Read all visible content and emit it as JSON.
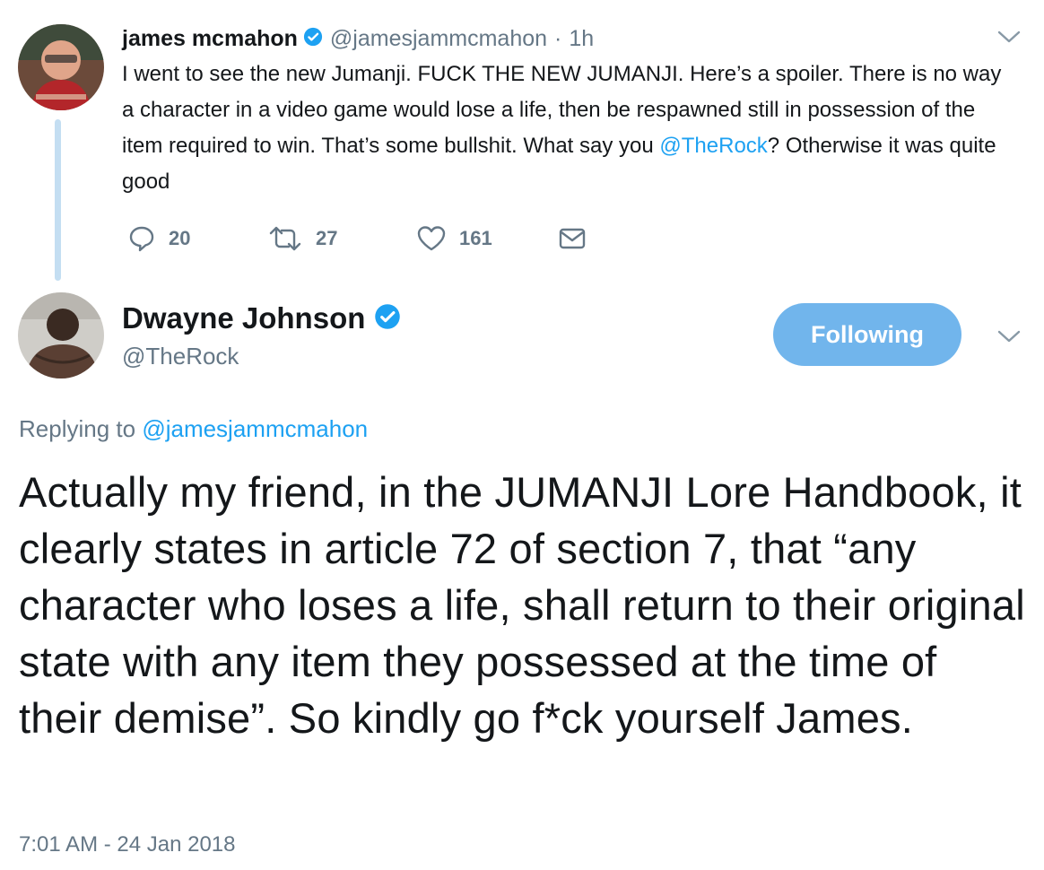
{
  "tweet1": {
    "name": "james mcmahon",
    "handle": "@jamesjammcmahon",
    "separator": "·",
    "time": "1h",
    "text_part1": "I went to see the new Jumanji. FUCK THE NEW JUMANJI. Here’s a spoiler. There is no way a character in a video game would lose a life, then be respawned still in possession of the item required to win. That’s some bullshit. What say you ",
    "mention": "@TheRock",
    "text_part2": "? Otherwise it was quite good",
    "actions": {
      "replies": "20",
      "retweets": "27",
      "likes": "161"
    }
  },
  "tweet2": {
    "name": "Dwayne Johnson",
    "handle": "@TheRock",
    "follow_label": "Following",
    "replying_prefix": "Replying to ",
    "replying_handle": "@jamesjammcmahon",
    "text": "Actually my friend, in the JUMANJI Lore Handbook, it clearly states in article 72 of section 7, that “any character who loses a life, shall return to their original state with any item they possessed at the time of their demise”. So kindly go f*ck yourself James.",
    "timestamp": "7:01 AM - 24 Jan 2018"
  },
  "icons": {
    "verified": "verified-badge-icon",
    "reply": "reply-icon",
    "retweet": "retweet-icon",
    "like": "heart-icon",
    "dm": "envelope-icon",
    "more": "chevron-down-icon"
  },
  "colors": {
    "link": "#1da1f2",
    "secondary": "#657786",
    "follow_button": "#71b5ec",
    "thread_line": "#c4def2"
  }
}
